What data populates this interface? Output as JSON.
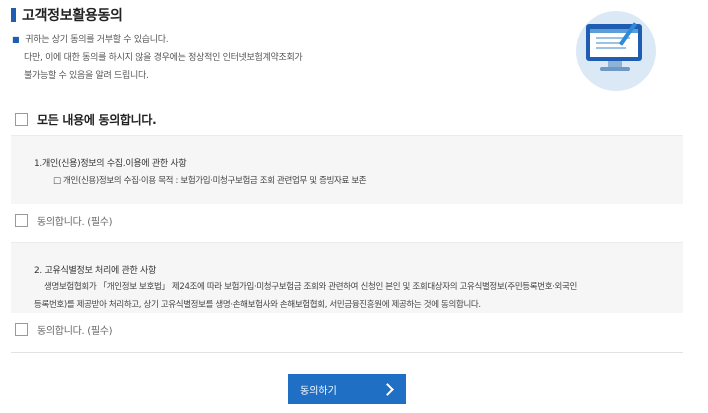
{
  "section": {
    "title": "고객정보활용동의",
    "notice_lines": [
      "귀하는 상기 동의를 거부할 수 있습니다.",
      "다만, 이에 대한 동의를 하시지 않을 경우에는 정상적인 인터넷보험계약조회가",
      "불가능할 수 있음을 알려 드립니다."
    ],
    "illustration_icon": "monitor-pen-icon",
    "accent_color": "#1f5db3"
  },
  "agree_all": {
    "label": "모든 내용에 동의합니다.",
    "checked": false
  },
  "clause1": {
    "title": "1.개인(신용)정보의 수집.이용에 관한 사항",
    "items": [
      "□ 개인(신용)정보의 수집·이용 목적 : 보험가입·미청구보험금 조회 관련업무 및 증빙자료 보존"
    ],
    "agree_label": "동의합니다. (필수)",
    "checked": false
  },
  "clause2": {
    "title": "2. 고유식별정보 처리에 관한 사항",
    "body_lines": [
      "생명보험협회가 「개인정보 보호법」 제24조에 따라 보험가입·미청구보험금 조회와 관련하여 신청인 본인 및 조회대상자의 고유식별정보(주민등록번호·외국인",
      "등록번호)를 제공받아 처리하고, 상기 고유식별정보를 생명·손해보험사와 손해보험협회, 서민금융진흥원에 제공하는 것에 동의합니다."
    ],
    "agree_label": "동의합니다. (필수)",
    "checked": false
  },
  "submit": {
    "label": "동의하기",
    "icon": "chevron-right-icon",
    "color": "#1f6fc5"
  }
}
